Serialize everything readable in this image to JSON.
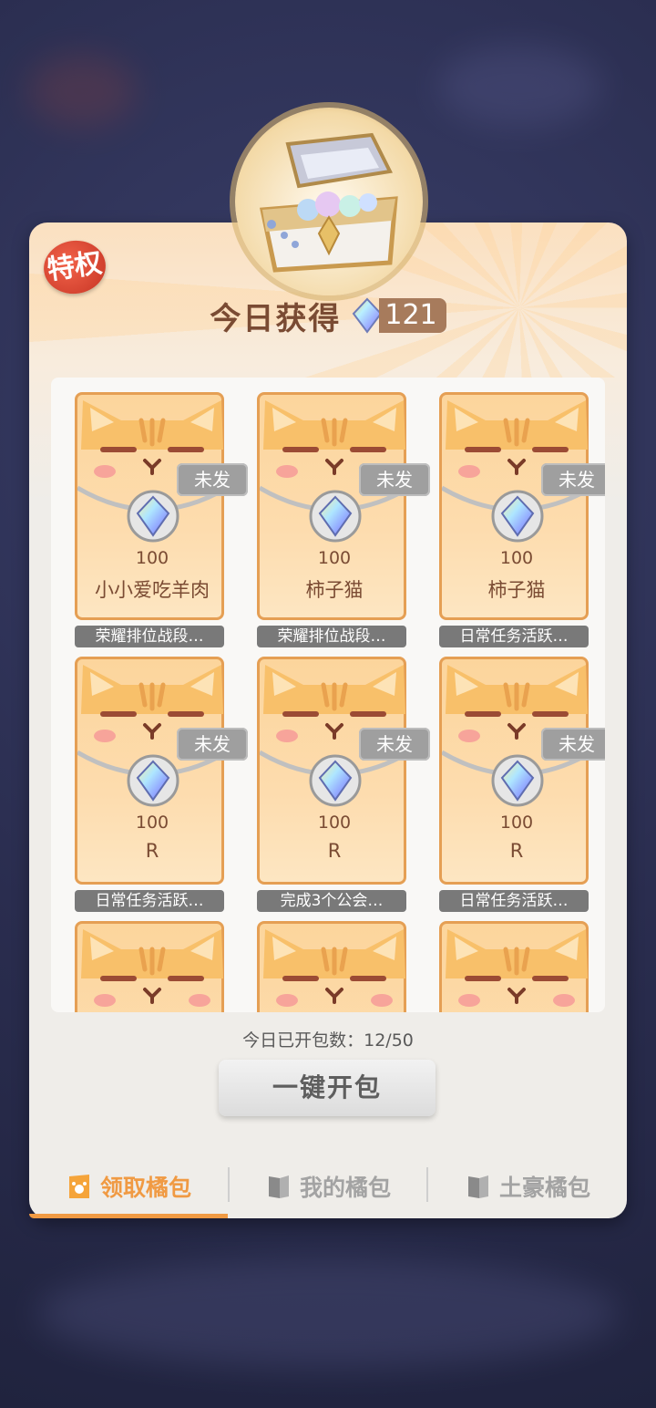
{
  "badge": {
    "label": "特权"
  },
  "header": {
    "title": "今日获得",
    "gem_count": "121"
  },
  "cards": [
    {
      "amount": "100",
      "name": "小小爱吃羊肉",
      "status": "未发",
      "source": "荣耀排位战段…"
    },
    {
      "amount": "100",
      "name": "柿子猫",
      "status": "未发",
      "source": "荣耀排位战段…"
    },
    {
      "amount": "100",
      "name": "柿子猫",
      "status": "未发",
      "source": "日常任务活跃…"
    },
    {
      "amount": "100",
      "name": "R",
      "status": "未发",
      "source": "日常任务活跃…"
    },
    {
      "amount": "100",
      "name": "R",
      "status": "未发",
      "source": "完成3个公会…"
    },
    {
      "amount": "100",
      "name": "R",
      "status": "未发",
      "source": "日常任务活跃…"
    },
    {
      "amount": "",
      "name": "",
      "status": "",
      "source": ""
    },
    {
      "amount": "",
      "name": "",
      "status": "",
      "source": ""
    },
    {
      "amount": "",
      "name": "",
      "status": "",
      "source": ""
    }
  ],
  "footer": {
    "opened_label": "今日已开包数：12/50",
    "one_key_button": "一键开包"
  },
  "tabs": [
    {
      "label": "领取橘包",
      "active": true,
      "icon": "orange-packet-icon"
    },
    {
      "label": "我的橘包",
      "active": false,
      "icon": "packet-icon"
    },
    {
      "label": "土豪橘包",
      "active": false,
      "icon": "packet-icon"
    }
  ],
  "colors": {
    "accent": "#f09a43",
    "text_brown": "#7a4b33",
    "tab_inactive": "#a3a3a3",
    "status_gray": "#9f9f9f"
  }
}
